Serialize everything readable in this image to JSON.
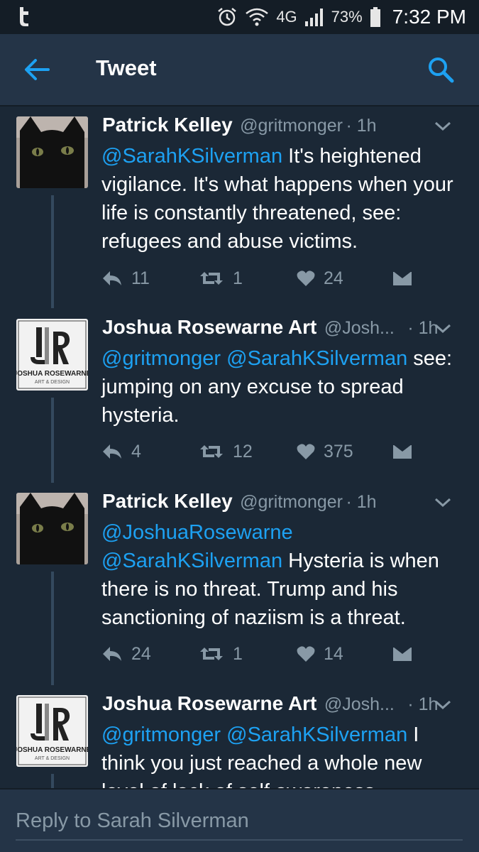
{
  "status_bar": {
    "battery": "73%",
    "time": "7:32 PM",
    "network": "4G"
  },
  "header": {
    "title": "Tweet"
  },
  "tweets": [
    {
      "name": "Patrick Kelley",
      "handle": "@gritmonger",
      "time": "· 1h",
      "mentions": [
        "@SarahKSilverman"
      ],
      "text": "It's heightened vigilance. It's what happens when your life is constantly threatened, see: refugees and abuse victims.",
      "replies": "11",
      "retweets": "1",
      "likes": "24"
    },
    {
      "name": "Joshua Rosewarne Art",
      "handle": "@Josh...",
      "time": "· 1h",
      "mentions": [
        "@gritmonger",
        "@SarahKSilverman"
      ],
      "text": "see: jumping on any excuse to spread hysteria.",
      "replies": "4",
      "retweets": "12",
      "likes": "375"
    },
    {
      "name": "Patrick Kelley",
      "handle": "@gritmonger",
      "time": "· 1h",
      "mentions": [
        "@JoshuaRosewarne",
        "@SarahKSilverman"
      ],
      "text": "Hysteria is when there is no threat.  Trump and his sanctioning of naziism is a threat.",
      "replies": "24",
      "retweets": "1",
      "likes": "14"
    },
    {
      "name": "Joshua Rosewarne Art",
      "handle": "@Josh...",
      "time": "· 1h",
      "mentions": [
        "@gritmonger",
        "@SarahKSilverman"
      ],
      "text": "I think you just reached a whole new level of lack of self awareness."
    }
  ],
  "avatars": {
    "jr_logo_name": "JOSHUA ROSEWARNE",
    "jr_logo_sub": "ART & DESIGN"
  },
  "reply": {
    "placeholder": "Reply to Sarah Silverman"
  },
  "colors": {
    "background": "#1b2836",
    "bar": "#243447",
    "accent": "#1da1f2",
    "muted": "#8899a6"
  }
}
